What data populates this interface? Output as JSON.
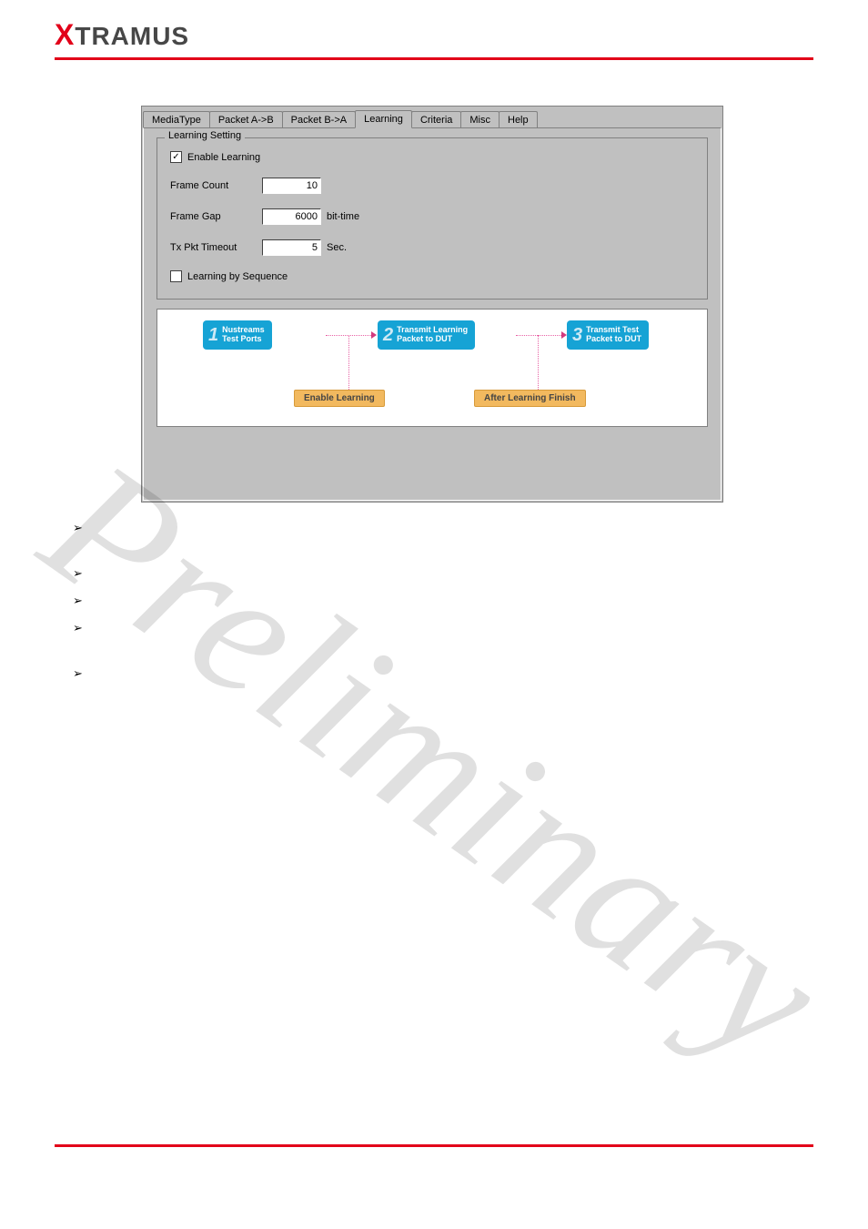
{
  "header": {
    "logo_x": "X",
    "logo_rest": "TRAMUS"
  },
  "tabs": [
    "MediaType",
    "Packet A->B",
    "Packet B->A",
    "Learning",
    "Criteria",
    "Misc",
    "Help"
  ],
  "active_tab_index": 3,
  "groupbox_title": "Learning Setting",
  "enable_learning": {
    "label": "Enable Learning",
    "checked": true
  },
  "frame_count": {
    "label": "Frame Count",
    "value": "10"
  },
  "frame_gap": {
    "label": "Frame Gap",
    "value": "6000",
    "unit": "bit-time"
  },
  "tx_pkt_timeout": {
    "label": "Tx Pkt Timeout",
    "value": "5",
    "unit": "Sec."
  },
  "learn_by_seq": {
    "label": "Learning by Sequence",
    "checked": false
  },
  "diagram": {
    "step1_num": "1",
    "step1_text1": "Nustreams",
    "step1_text2": "Test Ports",
    "step2_num": "2",
    "step2_text1": "Transmit Learning",
    "step2_text2": "Packet to DUT",
    "step3_num": "3",
    "step3_text1": "Transmit Test",
    "step3_text2": "Packet to DUT",
    "label1": "Enable Learning",
    "label2": "After Learning Finish"
  },
  "watermark": "Preliminary"
}
